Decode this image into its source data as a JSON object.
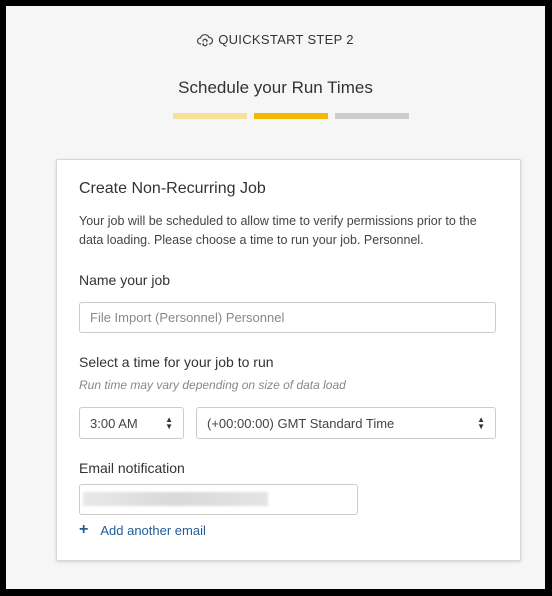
{
  "header": {
    "step_label": "QUICKSTART STEP 2",
    "icon": "cloud-sync-icon"
  },
  "page": {
    "title": "Schedule your Run Times"
  },
  "progress": {
    "steps": [
      {
        "state": "complete",
        "color": "#f7e19a"
      },
      {
        "state": "current",
        "color": "#f5b800"
      },
      {
        "state": "upcoming",
        "color": "#cccccc"
      }
    ]
  },
  "card": {
    "title": "Create Non-Recurring Job",
    "description": "Your job will be scheduled to allow time to verify permissions prior to the data loading. Please choose a time to run your job. Personnel.",
    "job_name": {
      "label": "Name your job",
      "placeholder": "File Import (Personnel) Personnel",
      "value": ""
    },
    "schedule": {
      "label": "Select a time for your job to run",
      "hint": "Run time may vary depending on size of data load",
      "time_value": "3:00 AM",
      "timezone_value": "(+00:00:00) GMT Standard Time"
    },
    "email": {
      "label": "Email notification",
      "add_label": "Add another email"
    }
  }
}
